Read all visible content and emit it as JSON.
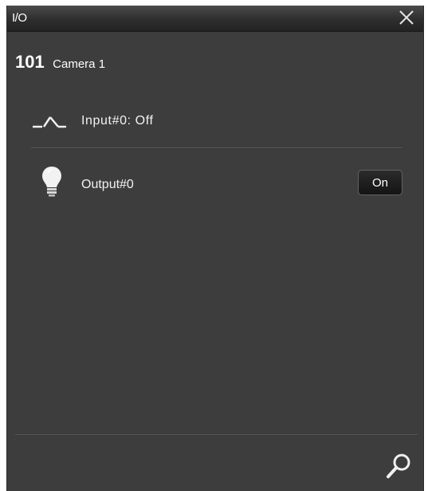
{
  "window": {
    "title": "I/O"
  },
  "camera": {
    "number": "101",
    "name": "Camera 1"
  },
  "inputs": [
    {
      "label": "Input#0: Off",
      "icon": "input-switch-icon"
    }
  ],
  "outputs": [
    {
      "label": "Output#0",
      "icon": "lightbulb-icon",
      "button_label": "On"
    }
  ],
  "footer": {
    "icon": "search-icon"
  }
}
